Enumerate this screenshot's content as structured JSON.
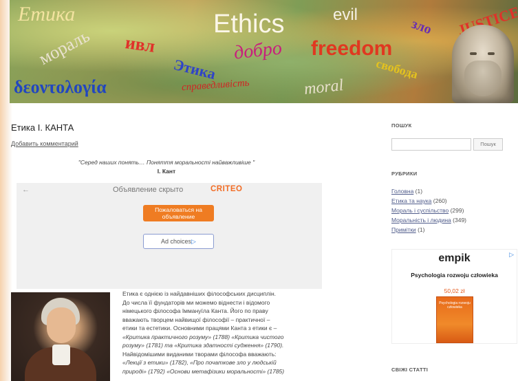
{
  "banner": {
    "words": {
      "etyka": "Етика",
      "moral_ua": "мораль",
      "ethics": "Ethics",
      "evil": "evil",
      "zlo": "зло",
      "justice": "JUSTICE",
      "dobro": "добро",
      "freedom": "freedom",
      "svoboda": "свобода",
      "etyka_small": "Этика",
      "deontology": "δεοντολογία",
      "spravedlyvist": "справедливість",
      "moral_en": "moral",
      "red_word": "ивл"
    }
  },
  "post": {
    "title": "Етика І. КАНТА",
    "comment_link": "Добавить комментарий",
    "quote": "\"Серед наших понять… Поняття моральності найважливіше \"",
    "quote_author": "І. Кант",
    "paragraph_lines": [
      "Етика є однією із найдавніших філософських дисциплін.",
      "До числа її фундаторів ми можемо віднести і відомого",
      "німецького філософа Іммануїла Канта. Його по праву",
      "вважають творцем найвищої філософії – практичної –",
      "етики та естетики. Основними працями Канта з етики є –",
      "«Критика практичного розуму» (1788) «Критика чистого",
      "розуму» (1781) та «Критика здатності судження» (1790).",
      "Найвідомішими виданими творами філософа вважають:",
      "«Лекції з етики» (1782), «Про початкове зло у людській",
      "природі» (1792) «Основи метафізики моральності» (1785)"
    ]
  },
  "ad": {
    "back_arrow": "←",
    "hidden_text": "Объявление скрыто",
    "criteo": "CRITEO",
    "report_button": "Пожаловаться на объявление",
    "ad_choices": "Ad choices"
  },
  "sidebar": {
    "search_heading": "ПОШУК",
    "search_button": "Пошук",
    "rubrics_heading": "РУБРИКИ",
    "categories": [
      {
        "label": "Головна",
        "count": "(1)"
      },
      {
        "label": "Етика та наука",
        "count": "(260)"
      },
      {
        "label": "Мораль і суспільство",
        "count": "(299)"
      },
      {
        "label": "Моральність і людина",
        "count": "(349)"
      },
      {
        "label": "Примітки",
        "count": "(1)"
      }
    ],
    "promo": {
      "logo": "empik",
      "product": "Psychologia rozwoju człowieka",
      "price": "50,02 zł",
      "book_title": "Psychologia rozwoju człowieka"
    },
    "fresh_heading": "СВІЖІ СТАТТІ"
  }
}
